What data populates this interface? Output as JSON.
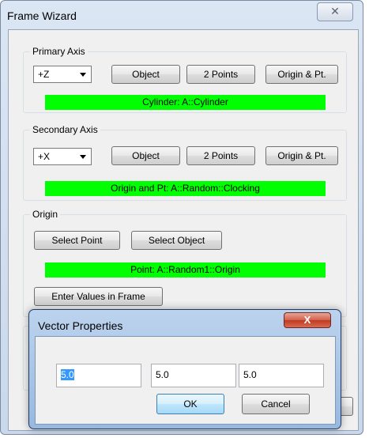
{
  "frame_wizard": {
    "title": "Frame Wizard",
    "close_glyph": "✕",
    "primary_axis": {
      "label": "Primary Axis",
      "axis_value": "+Z",
      "object_btn": "Object",
      "two_points_btn": "2 Points",
      "origin_pt_btn": "Origin & Pt.",
      "status": "Cylinder: A::Cylinder"
    },
    "secondary_axis": {
      "label": "Secondary Axis",
      "axis_value": "+X",
      "object_btn": "Object",
      "two_points_btn": "2 Points",
      "origin_pt_btn": "Origin & Pt.",
      "status": "Origin and Pt: A::Random::Clocking"
    },
    "origin": {
      "label": "Origin",
      "select_point_btn": "Select Point",
      "select_object_btn": "Select Object",
      "status": "Point: A::Random1::Origin",
      "enter_values_btn": "Enter Values in Frame"
    }
  },
  "vector_properties": {
    "title": "Vector Properties",
    "close_glyph": "X",
    "values": [
      "5.0",
      "5.0",
      "5.0"
    ],
    "ok_btn": "OK",
    "cancel_btn": "Cancel"
  },
  "colors": {
    "status_green": "#00ff00",
    "dialog_frame": "#98b8de",
    "close_red": "#c03a22",
    "selection": "#3399ff"
  },
  "icons": {
    "dropdown": "chevron-down-icon",
    "close": "close-icon"
  }
}
